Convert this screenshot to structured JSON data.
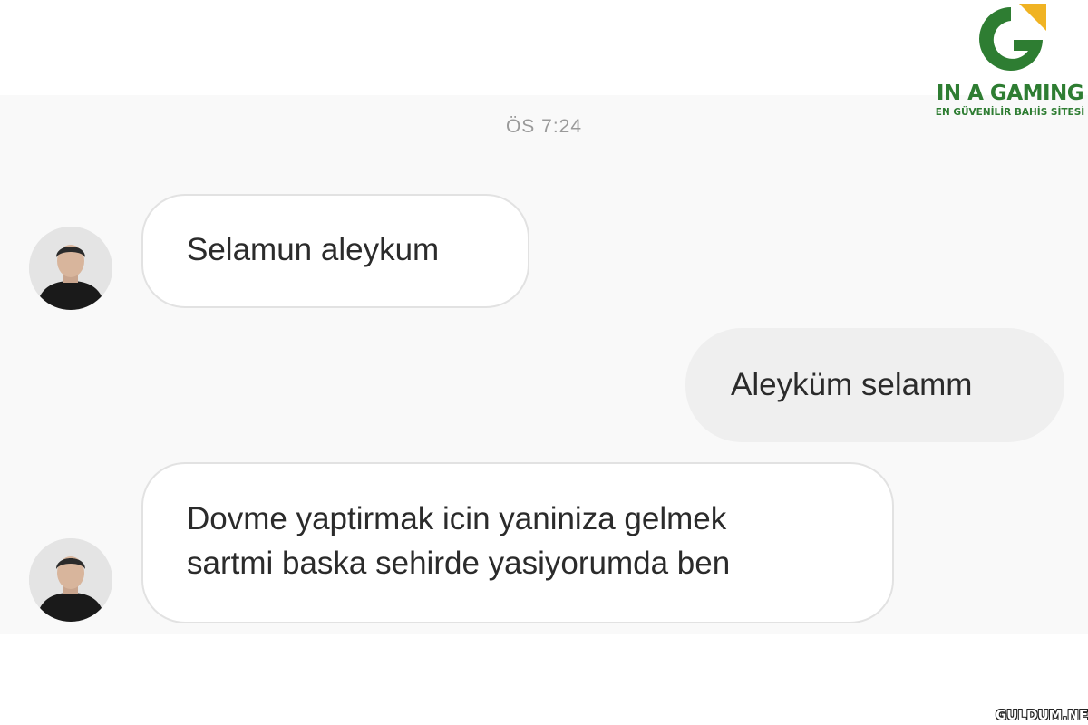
{
  "brand": {
    "name": "IN A GAMING",
    "tagline": "EN GÜVENİLİR BAHİS SİTESİ",
    "colors": {
      "green": "#2e7d32",
      "gold": "#f0b323"
    }
  },
  "chat": {
    "timestamp": "ÖS 7:24",
    "messages": [
      {
        "sender": "other",
        "avatar": "avatar-icon",
        "lines": [
          "Selamun aleykum"
        ]
      },
      {
        "sender": "self",
        "lines": [
          "Aleyküm selamm"
        ]
      },
      {
        "sender": "other",
        "avatar": "avatar-icon",
        "lines": [
          "Dovme yaptirmak icin yaniniza gelmek",
          "sartmi baska sehirde yasiyorumda ben"
        ]
      }
    ]
  },
  "watermark": "GULDUM.NET"
}
